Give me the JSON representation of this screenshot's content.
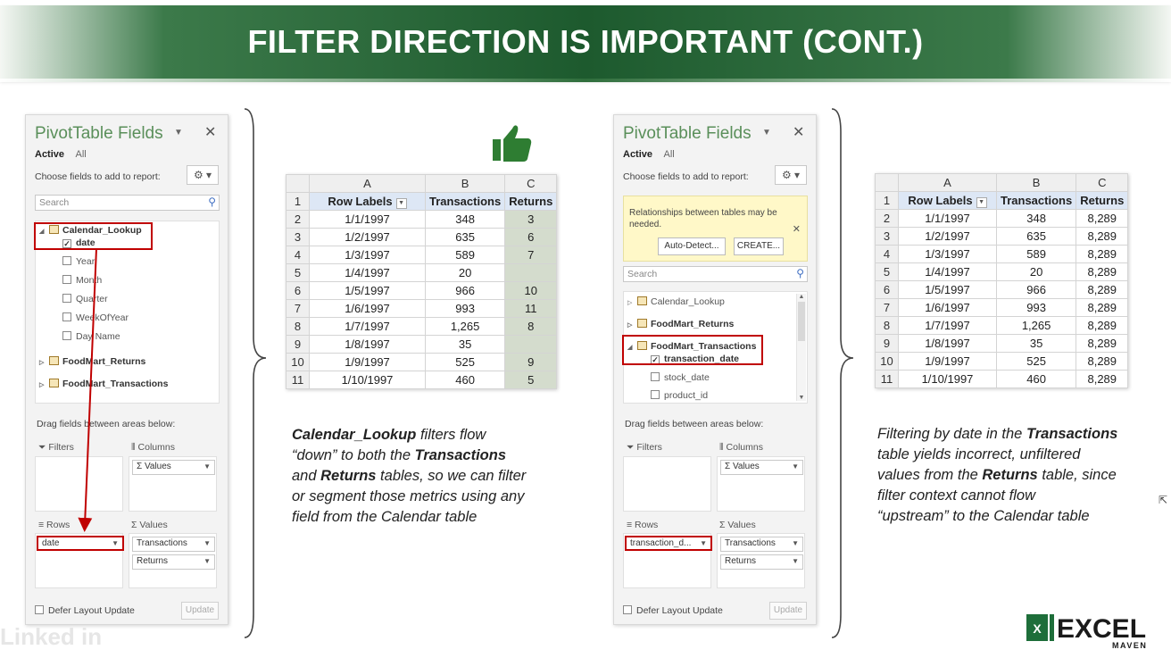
{
  "banner": {
    "title": "FILTER DIRECTION IS IMPORTANT (CONT.)"
  },
  "left_pane": {
    "title": "PivotTable Fields",
    "tab_active": "Active",
    "tab_all": "All",
    "choose": "Choose fields to add to report:",
    "search_placeholder": "Search",
    "table1": "Calendar_Lookup",
    "fields": [
      "date",
      "Year",
      "Month",
      "Quarter",
      "WeekOfYear",
      "Day Name"
    ],
    "table2": "FoodMart_Returns",
    "table3": "FoodMart_Transactions",
    "drag": "Drag fields between areas below:",
    "filters": "Filters",
    "columns": "Columns",
    "columns_pill": "Σ Values",
    "rows": "Rows",
    "values": "Values",
    "rows_pill": "date",
    "values_pills": [
      "Transactions",
      "Returns"
    ],
    "defer": "Defer Layout Update",
    "update": "Update"
  },
  "right_pane": {
    "title": "PivotTable Fields",
    "tab_active": "Active",
    "tab_all": "All",
    "choose": "Choose fields to add to report:",
    "notice": "Relationships between tables may be needed.",
    "auto_detect": "Auto-Detect...",
    "create": "CREATE...",
    "search_placeholder": "Search",
    "table1": "Calendar_Lookup",
    "table2": "FoodMart_Returns",
    "table3": "FoodMart_Transactions",
    "fields": [
      "transaction_date",
      "stock_date",
      "product_id"
    ],
    "drag": "Drag fields between areas below:",
    "filters": "Filters",
    "columns": "Columns",
    "columns_pill": "Σ Values",
    "rows": "Rows",
    "values": "Values",
    "rows_pill": "transaction_d...",
    "values_pills": [
      "Transactions",
      "Returns"
    ],
    "defer": "Defer Layout Update",
    "update": "Update"
  },
  "left_sheet": {
    "cols": [
      "A",
      "B",
      "C"
    ],
    "headers": [
      "Row Labels",
      "Transactions",
      "Returns"
    ],
    "rows": [
      [
        "1/1/1997",
        "348",
        "3"
      ],
      [
        "1/2/1997",
        "635",
        "6"
      ],
      [
        "1/3/1997",
        "589",
        "7"
      ],
      [
        "1/4/1997",
        "20",
        ""
      ],
      [
        "1/5/1997",
        "966",
        "10"
      ],
      [
        "1/6/1997",
        "993",
        "11"
      ],
      [
        "1/7/1997",
        "1,265",
        "8"
      ],
      [
        "1/8/1997",
        "35",
        ""
      ],
      [
        "1/9/1997",
        "525",
        "9"
      ],
      [
        "1/10/1997",
        "460",
        "5"
      ]
    ]
  },
  "right_sheet": {
    "cols": [
      "A",
      "B",
      "C"
    ],
    "headers": [
      "Row Labels",
      "Transactions",
      "Returns"
    ],
    "rows": [
      [
        "1/1/1997",
        "348",
        "8,289"
      ],
      [
        "1/2/1997",
        "635",
        "8,289"
      ],
      [
        "1/3/1997",
        "589",
        "8,289"
      ],
      [
        "1/4/1997",
        "20",
        "8,289"
      ],
      [
        "1/5/1997",
        "966",
        "8,289"
      ],
      [
        "1/6/1997",
        "993",
        "8,289"
      ],
      [
        "1/7/1997",
        "1,265",
        "8,289"
      ],
      [
        "1/8/1997",
        "35",
        "8,289"
      ],
      [
        "1/9/1997",
        "525",
        "8,289"
      ],
      [
        "1/10/1997",
        "460",
        "8,289"
      ]
    ]
  },
  "caption_left": {
    "t1": "Calendar_Lookup",
    "t2": " filters flow",
    "t3": "“down” to both the ",
    "t4": "Transactions",
    "t5": "and ",
    "t6": "Returns",
    "t7": " tables, so we can filter",
    "t8": "or segment those metrics using any",
    "t9": "field from the Calendar table"
  },
  "caption_right": {
    "t1": "Filtering by date in the ",
    "t2": "Transactions",
    "t3": "table yields incorrect, unfiltered",
    "t4": "values from the ",
    "t5": "Returns",
    "t6": " table, since",
    "t7": "filter context cannot flow",
    "t8": "“upstream” to the Calendar table"
  },
  "watermark": "Linked in",
  "logo": {
    "excel": "EXCEL",
    "maven": "MAVEN",
    "x": "X"
  },
  "icons": [
    "thumbs-up-icon",
    "gear-icon",
    "search-icon",
    "close-icon",
    "table-icon",
    "checkbox-icon",
    "funnel-icon",
    "sigma-icon",
    "mouse-cursor-icon"
  ]
}
